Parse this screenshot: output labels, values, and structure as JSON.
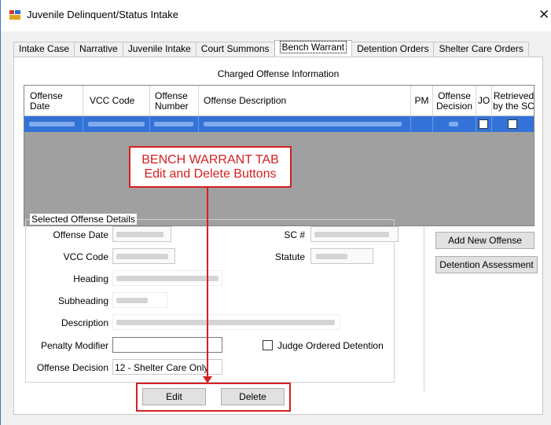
{
  "window": {
    "title": "Juvenile Delinquent/Status Intake"
  },
  "tabs": [
    "Intake Case",
    "Narrative",
    "Juvenile Intake",
    "Court Summons",
    "Bench Warrant",
    "Detention Orders",
    "Shelter Care Orders"
  ],
  "grid": {
    "caption": "Charged Offense Information",
    "columns": [
      "Offense Date",
      "VCC Code",
      "Offense Number",
      "Offense Description",
      "PM",
      "Offense Decision",
      "JO",
      "Retrieved by the SC"
    ]
  },
  "details": {
    "legend": "Selected Offense Details",
    "labels": {
      "offense_date": "Offense Date",
      "vcc_code": "VCC Code",
      "heading": "Heading",
      "subheading": "Subheading",
      "description": "Description",
      "penalty_modifier": "Penalty Modifier",
      "offense_decision": "Offense Decision",
      "sc": "SC #",
      "statute": "Statute"
    },
    "offense_decision_value": "12 - Shelter Care Only",
    "judge_ordered_label": "Judge Ordered Detention"
  },
  "buttons": {
    "add_new_offense": "Add New Offense",
    "detention_assessment": "Detention Assessment",
    "edit": "Edit",
    "delete": "Delete"
  },
  "annotation": {
    "line1": "BENCH WARRANT TAB",
    "line2": "Edit and Delete Buttons",
    "color": "#d42020"
  }
}
